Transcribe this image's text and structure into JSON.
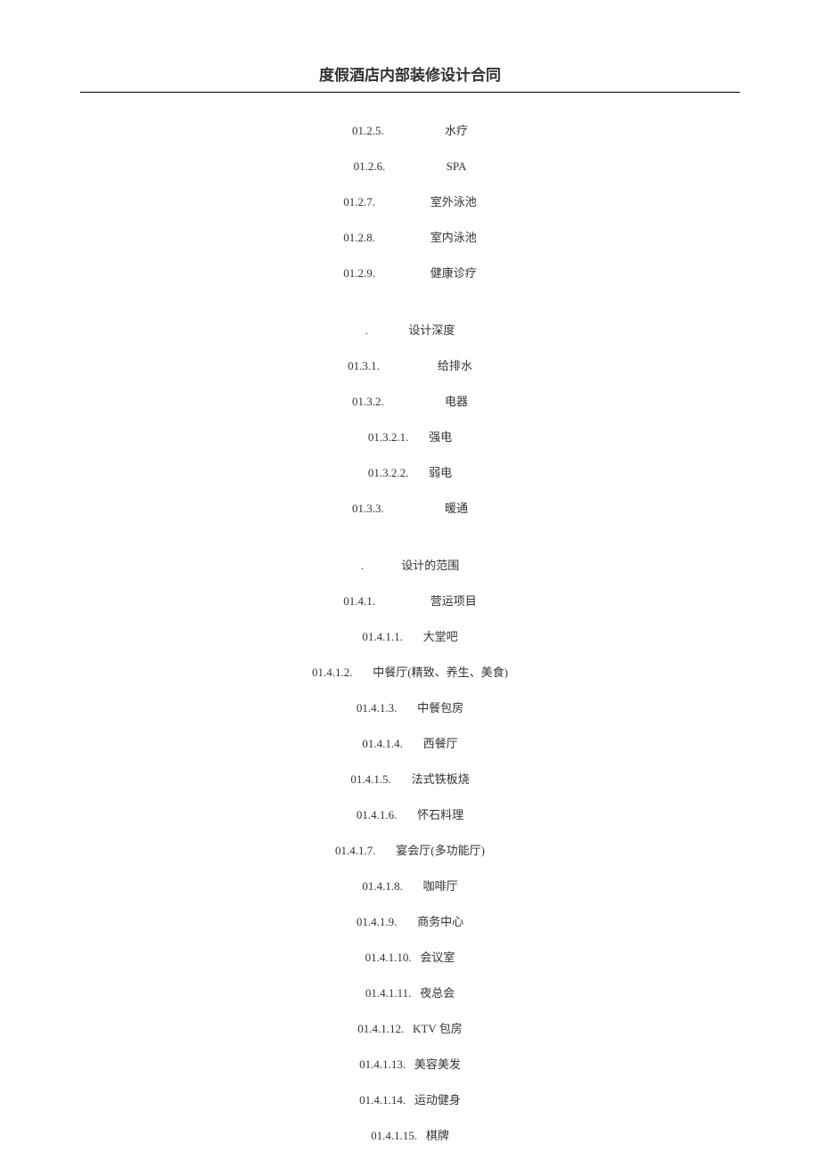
{
  "header": {
    "title": "度假酒店内部装修设计合同"
  },
  "sections": [
    {
      "items": [
        {
          "num": "01.2.5.",
          "label": "水疗",
          "gap": "                     "
        },
        {
          "num": "01.2.6.",
          "label": "SPA",
          "gap": "                     "
        },
        {
          "num": "01.2.7.",
          "label": "室外泳池",
          "gap": "                   "
        },
        {
          "num": "01.2.8.",
          "label": "室内泳池",
          "gap": "                   "
        },
        {
          "num": "01.2.9.",
          "label": "健康诊疗",
          "gap": "                   "
        }
      ]
    },
    {
      "heading": {
        "num": ".",
        "label": "设计深度",
        "gap": "              "
      },
      "items": [
        {
          "num": "01.3.1.",
          "label": "给排水",
          "gap": "                    "
        },
        {
          "num": "01.3.2.",
          "label": "电器",
          "gap": "                     "
        },
        {
          "num": "01.3.2.1.",
          "label": "强电",
          "gap": "       "
        },
        {
          "num": "01.3.2.2.",
          "label": "弱电",
          "gap": "       "
        },
        {
          "num": "01.3.3.",
          "label": "暖通",
          "gap": "                     "
        }
      ]
    },
    {
      "heading": {
        "num": ".",
        "label": "设计的范围",
        "gap": "             "
      },
      "items": [
        {
          "num": "01.4.1.",
          "label": "营运项目",
          "gap": "                   "
        },
        {
          "num": "01.4.1.1.",
          "label": "大堂吧",
          "gap": "       "
        },
        {
          "num": "01.4.1.2.",
          "label": "中餐厅(精致、养生、美食)",
          "gap": "       "
        },
        {
          "num": "01.4.1.3.",
          "label": "中餐包房",
          "gap": "       "
        },
        {
          "num": "01.4.1.4.",
          "label": "西餐厅",
          "gap": "       "
        },
        {
          "num": "01.4.1.5.",
          "label": "法式铁板烧",
          "gap": "       "
        },
        {
          "num": "01.4.1.6.",
          "label": "怀石料理",
          "gap": "       "
        },
        {
          "num": "01.4.1.7.",
          "label": "宴会厅(多功能厅)",
          "gap": "       "
        },
        {
          "num": "01.4.1.8.",
          "label": "咖啡厅",
          "gap": "       "
        },
        {
          "num": "01.4.1.9.",
          "label": "商务中心",
          "gap": "       "
        },
        {
          "num": "01.4.1.10.",
          "label": "会议室",
          "gap": "   "
        },
        {
          "num": "01.4.1.11.",
          "label": "夜总会",
          "gap": "   "
        },
        {
          "num": "01.4.1.12.",
          "label": "KTV 包房",
          "gap": "   "
        },
        {
          "num": "01.4.1.13.",
          "label": "美容美发",
          "gap": "   "
        },
        {
          "num": "01.4.1.14.",
          "label": "运动健身",
          "gap": "   "
        },
        {
          "num": "01.4.1.15.",
          "label": "棋牌",
          "gap": "   "
        }
      ]
    }
  ]
}
